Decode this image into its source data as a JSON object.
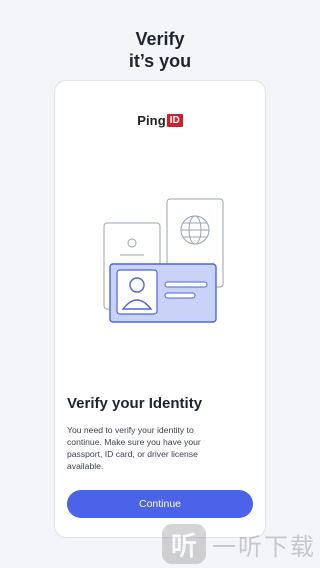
{
  "header": {
    "title_line1": "Verify",
    "title_line2": "it’s you"
  },
  "logo": {
    "text": "Ping",
    "badge": "ID"
  },
  "content": {
    "heading": "Verify your Identity",
    "description": "You need to verify your identity to continue. Make sure you have your passport, ID card, or driver license available."
  },
  "actions": {
    "continue_label": "Continue"
  },
  "watermark": {
    "icon": "听",
    "text": "一听下载"
  },
  "colors": {
    "accent": "#4a63e8",
    "brand_red": "#cc2229",
    "card_bg": "#c9d3f7"
  }
}
